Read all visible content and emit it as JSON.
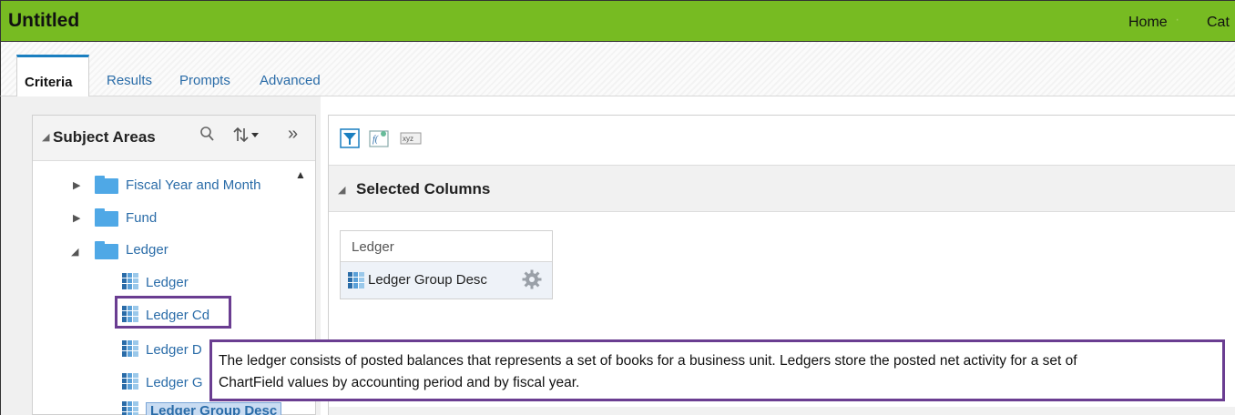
{
  "app": {
    "title": "Untitled",
    "nav": {
      "home": "Home",
      "separator": "·",
      "catalog": "Cat"
    }
  },
  "tabs": [
    {
      "label": "Criteria",
      "active": true
    },
    {
      "label": "Results"
    },
    {
      "label": "Prompts"
    },
    {
      "label": "Advanced"
    }
  ],
  "subject_areas": {
    "title": "Subject Areas",
    "icons": [
      "search-icon",
      "sort-icon",
      "expand-panel-icon"
    ],
    "tree": [
      {
        "label": "Fiscal Year and Month",
        "type": "folder",
        "expanded": false
      },
      {
        "label": "Fund",
        "type": "folder",
        "expanded": false
      },
      {
        "label": "Ledger",
        "type": "folder",
        "expanded": true
      },
      {
        "label": "Ledger",
        "type": "column"
      },
      {
        "label": "Ledger Cd",
        "type": "column"
      },
      {
        "label": "Ledger D",
        "type": "column"
      },
      {
        "label": "Ledger G",
        "type": "column"
      },
      {
        "label": "Ledger Group Desc",
        "type": "column",
        "selected": true
      }
    ]
  },
  "toolbar": {
    "icons": [
      "filter-icon",
      "column-properties-icon",
      "xyz-icon"
    ]
  },
  "selected_columns": {
    "title": "Selected Columns",
    "group": "Ledger",
    "column": "Ledger Group Desc"
  },
  "tooltip": {
    "line1": "The ledger consists of posted balances that represents a set of books for a business unit. Ledgers store the posted net activity for a set of",
    "line2": "ChartField values by accounting period and by fiscal year."
  },
  "colors": {
    "titlebar": "#77bb22",
    "link": "#2a6ca8",
    "highlight": "#6a3d91"
  }
}
